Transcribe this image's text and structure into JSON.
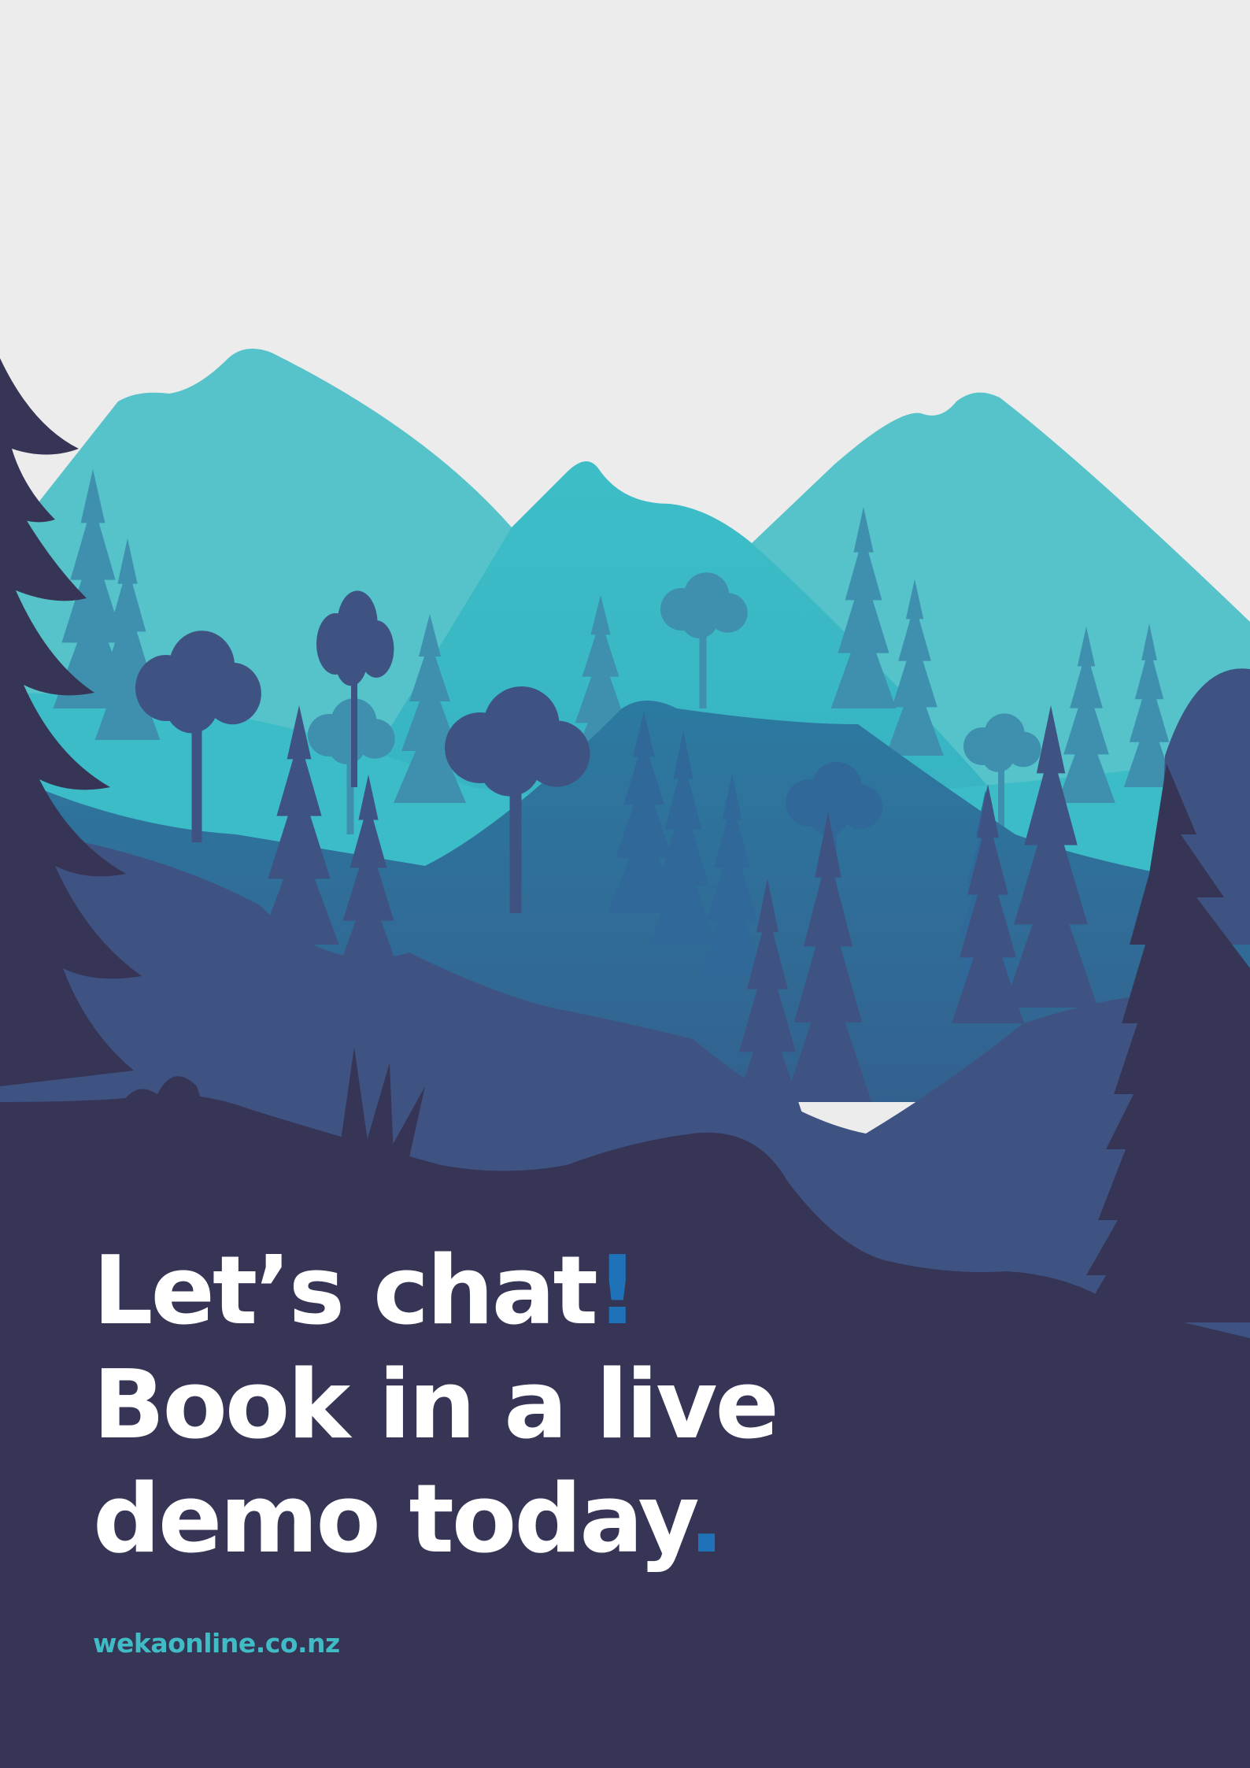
{
  "headline": {
    "line1_text": "Let’s chat",
    "line1_accent": "!",
    "line2_text": "Book in a live",
    "line3_text": "demo today",
    "line3_accent": "."
  },
  "website": "wekaonline.co.nz",
  "colors": {
    "sky": "#ececec",
    "mountain_far": "#55c3c9",
    "mountain_mid": "#3dbec7",
    "forest_blue": "#2f77a0",
    "forest_indigo": "#3f5383",
    "foreground_dark": "#373555",
    "accent_blue": "#1f72b8",
    "website_teal": "#3fbcc5",
    "headline_white": "#ffffff"
  },
  "icons": [
    "mountain-illustration",
    "tree-silhouette"
  ]
}
